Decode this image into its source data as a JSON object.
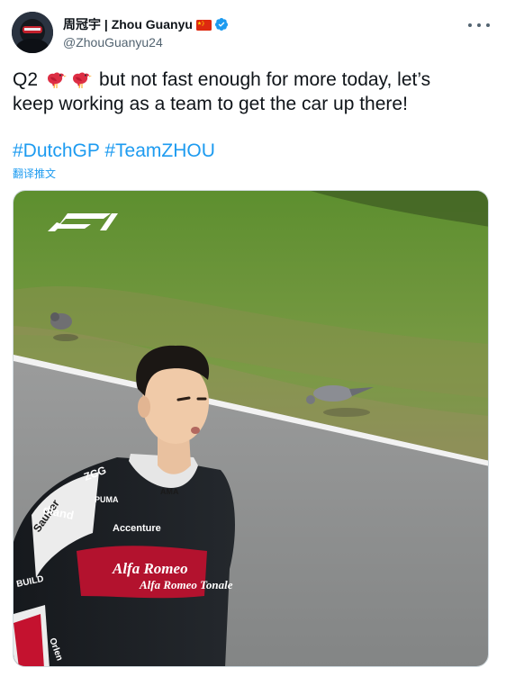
{
  "author": {
    "name": "周冠宇 | Zhou Guanyu",
    "handle": "@ZhouGuanyu24",
    "flag": "china-flag-icon",
    "verified": "verified-badge-icon"
  },
  "tweet": {
    "line1_prefix": "Q2",
    "line1_suffix": "but not fast enough for more today, let’s",
    "line2": "keep working as a team to get the car up there!",
    "emoji": "bird-emoji",
    "hashtags": [
      "#DutchGP",
      "#TeamZHOU"
    ],
    "translate": "翻译推文"
  },
  "photo": {
    "logo": "F1",
    "suit_texts": [
      "ZCG",
      "PUMA",
      "Accenture",
      "Alfa Romeo",
      "Orlen",
      "Sauber",
      "Alfa Romeo Tonale",
      "AMA",
      "BUILD",
      "dland"
    ]
  },
  "colors": {
    "link": "#1d9bf0",
    "text": "#0f1419",
    "secondary": "#536471",
    "verified": "#1d9bf0",
    "grass": "#6a8f3a",
    "asphalt": "#8f9090",
    "suit_red": "#b3122e"
  }
}
